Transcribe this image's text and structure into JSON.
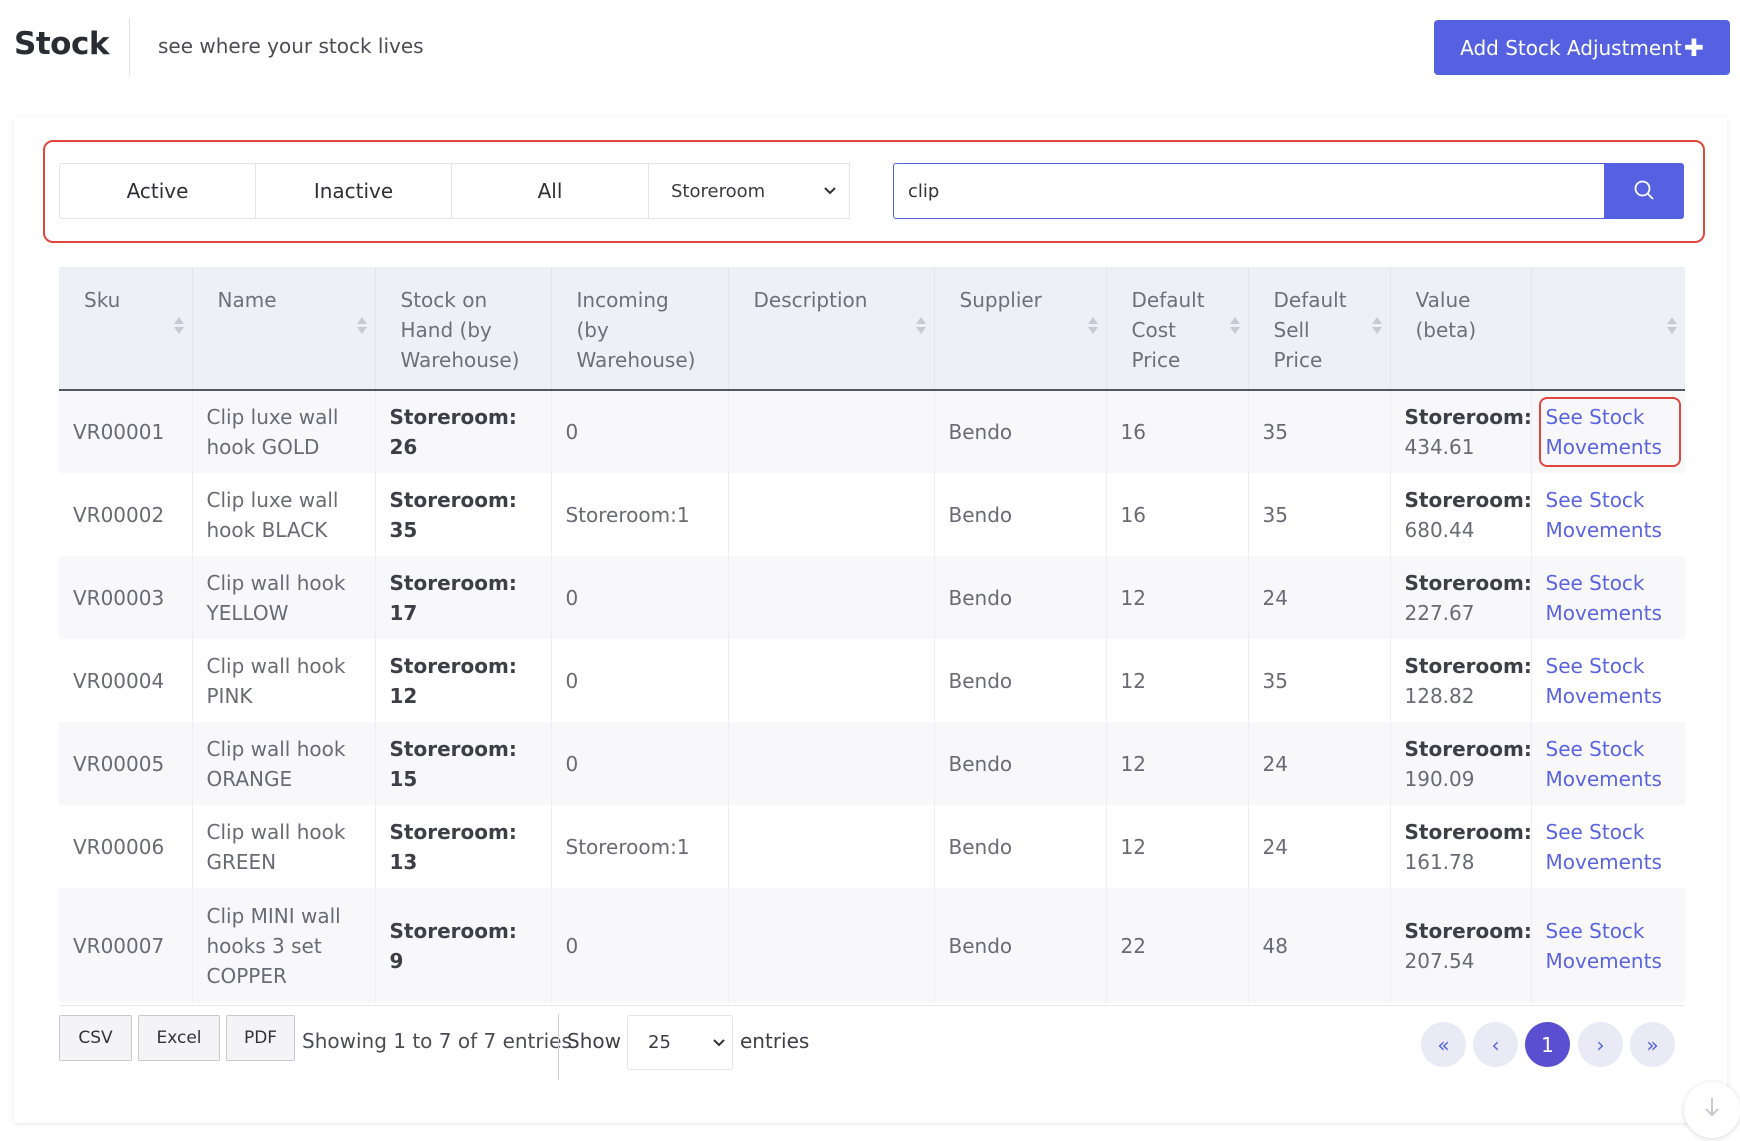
{
  "header": {
    "title": "Stock",
    "subtitle": "see where your stock lives",
    "add_button_label": "Add Stock Adjustment",
    "add_button_icon": "plus-icon"
  },
  "filters": {
    "status_tabs": [
      "Active",
      "Inactive",
      "All"
    ],
    "warehouse_select": "Storeroom",
    "search_value": "clip",
    "search_icon": "search-icon"
  },
  "table": {
    "columns": [
      "Sku",
      "Name",
      "Stock on Hand (by Warehouse)",
      "Incoming (by Warehouse)",
      "Description",
      "Supplier",
      "Default Cost Price",
      "Default Sell Price",
      "Value (beta)",
      ""
    ],
    "rows": [
      {
        "sku": "VR00001",
        "name": "Clip luxe wall hook GOLD",
        "stock_label": "Storeroom:",
        "stock_value": "26",
        "incoming": "0",
        "description": "",
        "supplier": "Bendo",
        "cost": "16",
        "sell": "35",
        "value_label": "Storeroom:",
        "value_amount": "434.61",
        "action": "See Stock Movements"
      },
      {
        "sku": "VR00002",
        "name": "Clip luxe wall hook BLACK",
        "stock_label": "Storeroom:",
        "stock_value": "35",
        "incoming": "Storeroom:1",
        "description": "",
        "supplier": "Bendo",
        "cost": "16",
        "sell": "35",
        "value_label": "Storeroom:",
        "value_amount": "680.44",
        "action": "See Stock Movements"
      },
      {
        "sku": "VR00003",
        "name": "Clip wall hook YELLOW",
        "stock_label": "Storeroom:",
        "stock_value": "17",
        "incoming": "0",
        "description": "",
        "supplier": "Bendo",
        "cost": "12",
        "sell": "24",
        "value_label": "Storeroom:",
        "value_amount": "227.67",
        "action": "See Stock Movements"
      },
      {
        "sku": "VR00004",
        "name": "Clip wall hook PINK",
        "stock_label": "Storeroom:",
        "stock_value": "12",
        "incoming": "0",
        "description": "",
        "supplier": "Bendo",
        "cost": "12",
        "sell": "35",
        "value_label": "Storeroom:",
        "value_amount": "128.82",
        "action": "See Stock Movements"
      },
      {
        "sku": "VR00005",
        "name": "Clip wall hook ORANGE",
        "stock_label": "Storeroom:",
        "stock_value": "15",
        "incoming": "0",
        "description": "",
        "supplier": "Bendo",
        "cost": "12",
        "sell": "24",
        "value_label": "Storeroom:",
        "value_amount": "190.09",
        "action": "See Stock Movements"
      },
      {
        "sku": "VR00006",
        "name": "Clip wall hook GREEN",
        "stock_label": "Storeroom:",
        "stock_value": "13",
        "incoming": "Storeroom:1",
        "description": "",
        "supplier": "Bendo",
        "cost": "12",
        "sell": "24",
        "value_label": "Storeroom:",
        "value_amount": "161.78",
        "action": "See Stock Movements"
      },
      {
        "sku": "VR00007",
        "name": "Clip MINI wall hooks 3 set COPPER",
        "stock_label": "Storeroom:",
        "stock_value": "9",
        "incoming": "0",
        "description": "",
        "supplier": "Bendo",
        "cost": "22",
        "sell": "48",
        "value_label": "Storeroom:",
        "value_amount": "207.54",
        "action": "See Stock Movements"
      }
    ]
  },
  "footer": {
    "export_buttons": [
      "CSV",
      "Excel",
      "PDF"
    ],
    "info": "Showing 1 to 7 of 7 entries",
    "show_label": "Show",
    "page_length": "25",
    "entries_label": "entries",
    "pagination": {
      "first": "«",
      "prev": "‹",
      "current": "1",
      "next": "›",
      "last": "»"
    }
  },
  "colors": {
    "accent": "#5561e0",
    "highlight": "#e0463d",
    "link": "#5a64e0",
    "header_bg": "#eef0f8"
  }
}
